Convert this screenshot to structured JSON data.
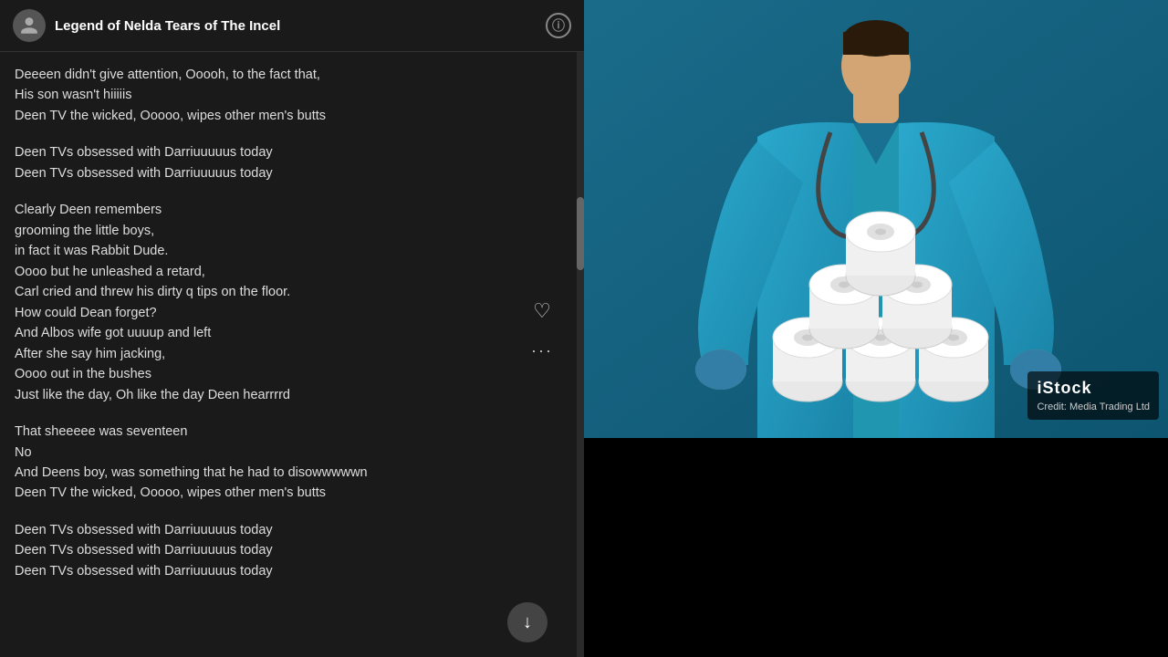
{
  "header": {
    "title": "Legend of Nelda Tears of The Incel",
    "info_icon": "ⓘ"
  },
  "lyrics": {
    "blocks": [
      {
        "lines": [
          "Deeeen didn't give attention, Ooooh, to the fact that,",
          "His son wasn't hiiiiis",
          "Deen TV the wicked, Ooooo, wipes other men's butts"
        ]
      },
      {
        "lines": [
          "Deen TVs obsessed with Darriuuuuus today",
          "Deen TVs obsessed with Darriuuuuus today"
        ]
      },
      {
        "lines": [
          "Clearly Deen remembers",
          "grooming the little boys,",
          "in fact it was Rabbit Dude.",
          "Oooo but he unleashed a retard,",
          "Carl cried and threw his dirty q tips on the floor.",
          "How could Dean forget?",
          "And Albos wife got uuuup and left",
          "After she say him jacking,",
          "Oooo out in the bushes",
          "Just like the day, Oh like the day Deen hearrrrd"
        ]
      },
      {
        "lines": [
          "That sheeeee was seventeen",
          "No",
          "And Deens boy, was something that he had to disowwwwwn",
          "Deen TV the wicked, Ooooo, wipes other men's butts"
        ]
      },
      {
        "lines": [
          "Deen TVs obsessed with Darriuuuuus today",
          "Deen TVs obsessed with Darriuuuuus today",
          "Deen TVs obsessed with Darriuuuuus today"
        ]
      }
    ]
  },
  "actions": {
    "like_icon": "♡",
    "more_icon": "···",
    "download_icon": "↓"
  },
  "image": {
    "credit_brand": "iStock",
    "credit_line": "Credit: Media Trading Ltd"
  },
  "colors": {
    "bg": "#1a1a1a",
    "text": "#ddd",
    "accent": "#444",
    "scrubs": "#2196b0"
  }
}
